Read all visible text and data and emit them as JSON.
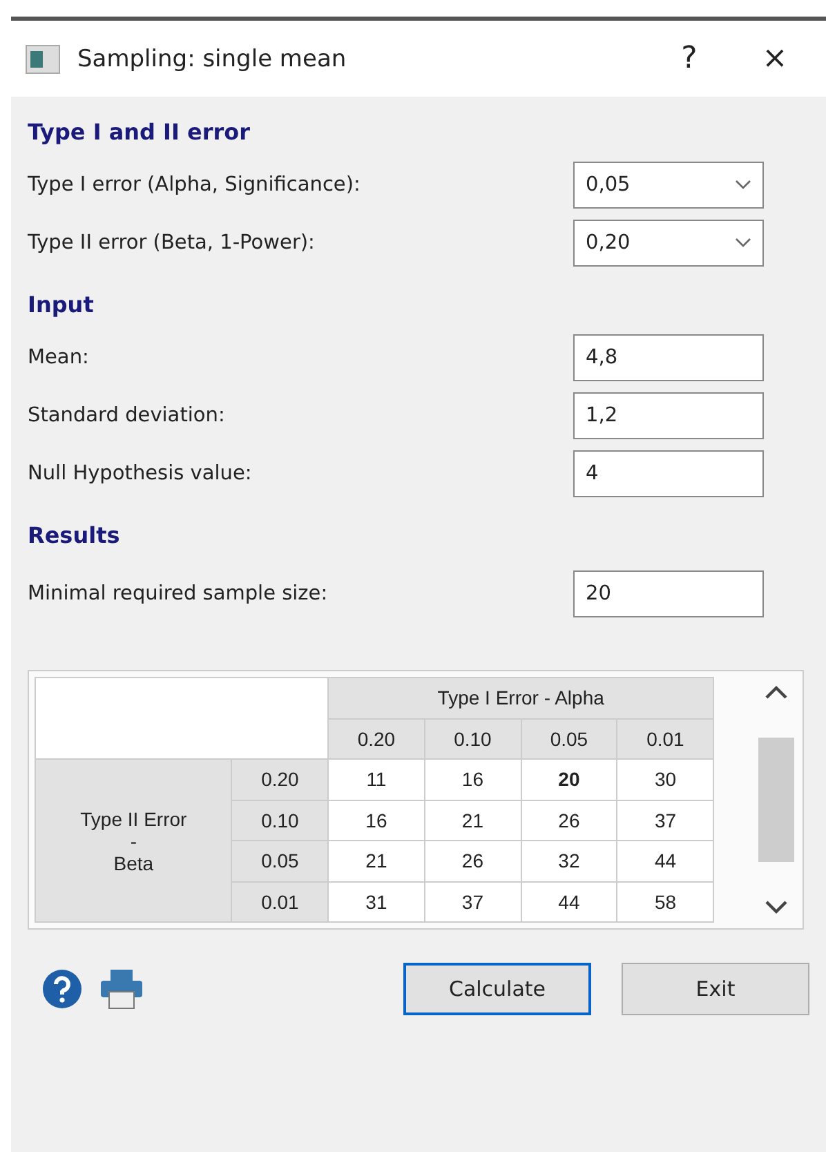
{
  "window": {
    "title": "Sampling: single mean",
    "help": "?",
    "close": "×"
  },
  "sections": [
    {
      "heading": "Type I and II error",
      "fields": [
        {
          "kind": "dropdown",
          "label": "Type I error (Alpha, Significance):",
          "value": "0,05"
        },
        {
          "kind": "dropdown",
          "label": "Type II error (Beta, 1-Power):",
          "value": "0,20"
        }
      ]
    },
    {
      "heading": "Input",
      "fields": [
        {
          "kind": "text",
          "label": "Mean:",
          "value": "4,8"
        },
        {
          "kind": "text",
          "label": "Standard deviation:",
          "value": "1,2"
        },
        {
          "kind": "text",
          "label": "Null Hypothesis value:",
          "value": "4"
        }
      ]
    },
    {
      "heading": "Results",
      "fields": [
        {
          "kind": "text",
          "label": "Minimal required sample size:",
          "value": "20"
        }
      ]
    }
  ],
  "table": {
    "column_header": "Type I Error - Alpha",
    "row_header_lines": [
      "Type II Error",
      "-",
      "Beta"
    ],
    "columns": [
      "0.20",
      "0.10",
      "0.05",
      "0.01"
    ],
    "rows": [
      {
        "label": "0.20",
        "cells": [
          {
            "value": "11",
            "selected": false
          },
          {
            "value": "16",
            "selected": false
          },
          {
            "value": "20",
            "selected": true
          },
          {
            "value": "30",
            "selected": false
          }
        ]
      },
      {
        "label": "0.10",
        "cells": [
          {
            "value": "16",
            "selected": false
          },
          {
            "value": "21",
            "selected": false
          },
          {
            "value": "26",
            "selected": false
          },
          {
            "value": "37",
            "selected": false
          }
        ]
      },
      {
        "label": "0.05",
        "cells": [
          {
            "value": "21",
            "selected": false
          },
          {
            "value": "26",
            "selected": false
          },
          {
            "value": "32",
            "selected": false
          },
          {
            "value": "44",
            "selected": false
          }
        ]
      },
      {
        "label": "0.01",
        "cells": [
          {
            "value": "31",
            "selected": false
          },
          {
            "value": "37",
            "selected": false
          },
          {
            "value": "44",
            "selected": false
          },
          {
            "value": "58",
            "selected": false
          }
        ]
      }
    ]
  },
  "buttons": [
    {
      "label": "Calculate",
      "selected": true
    },
    {
      "label": "Exit",
      "selected": false
    }
  ]
}
